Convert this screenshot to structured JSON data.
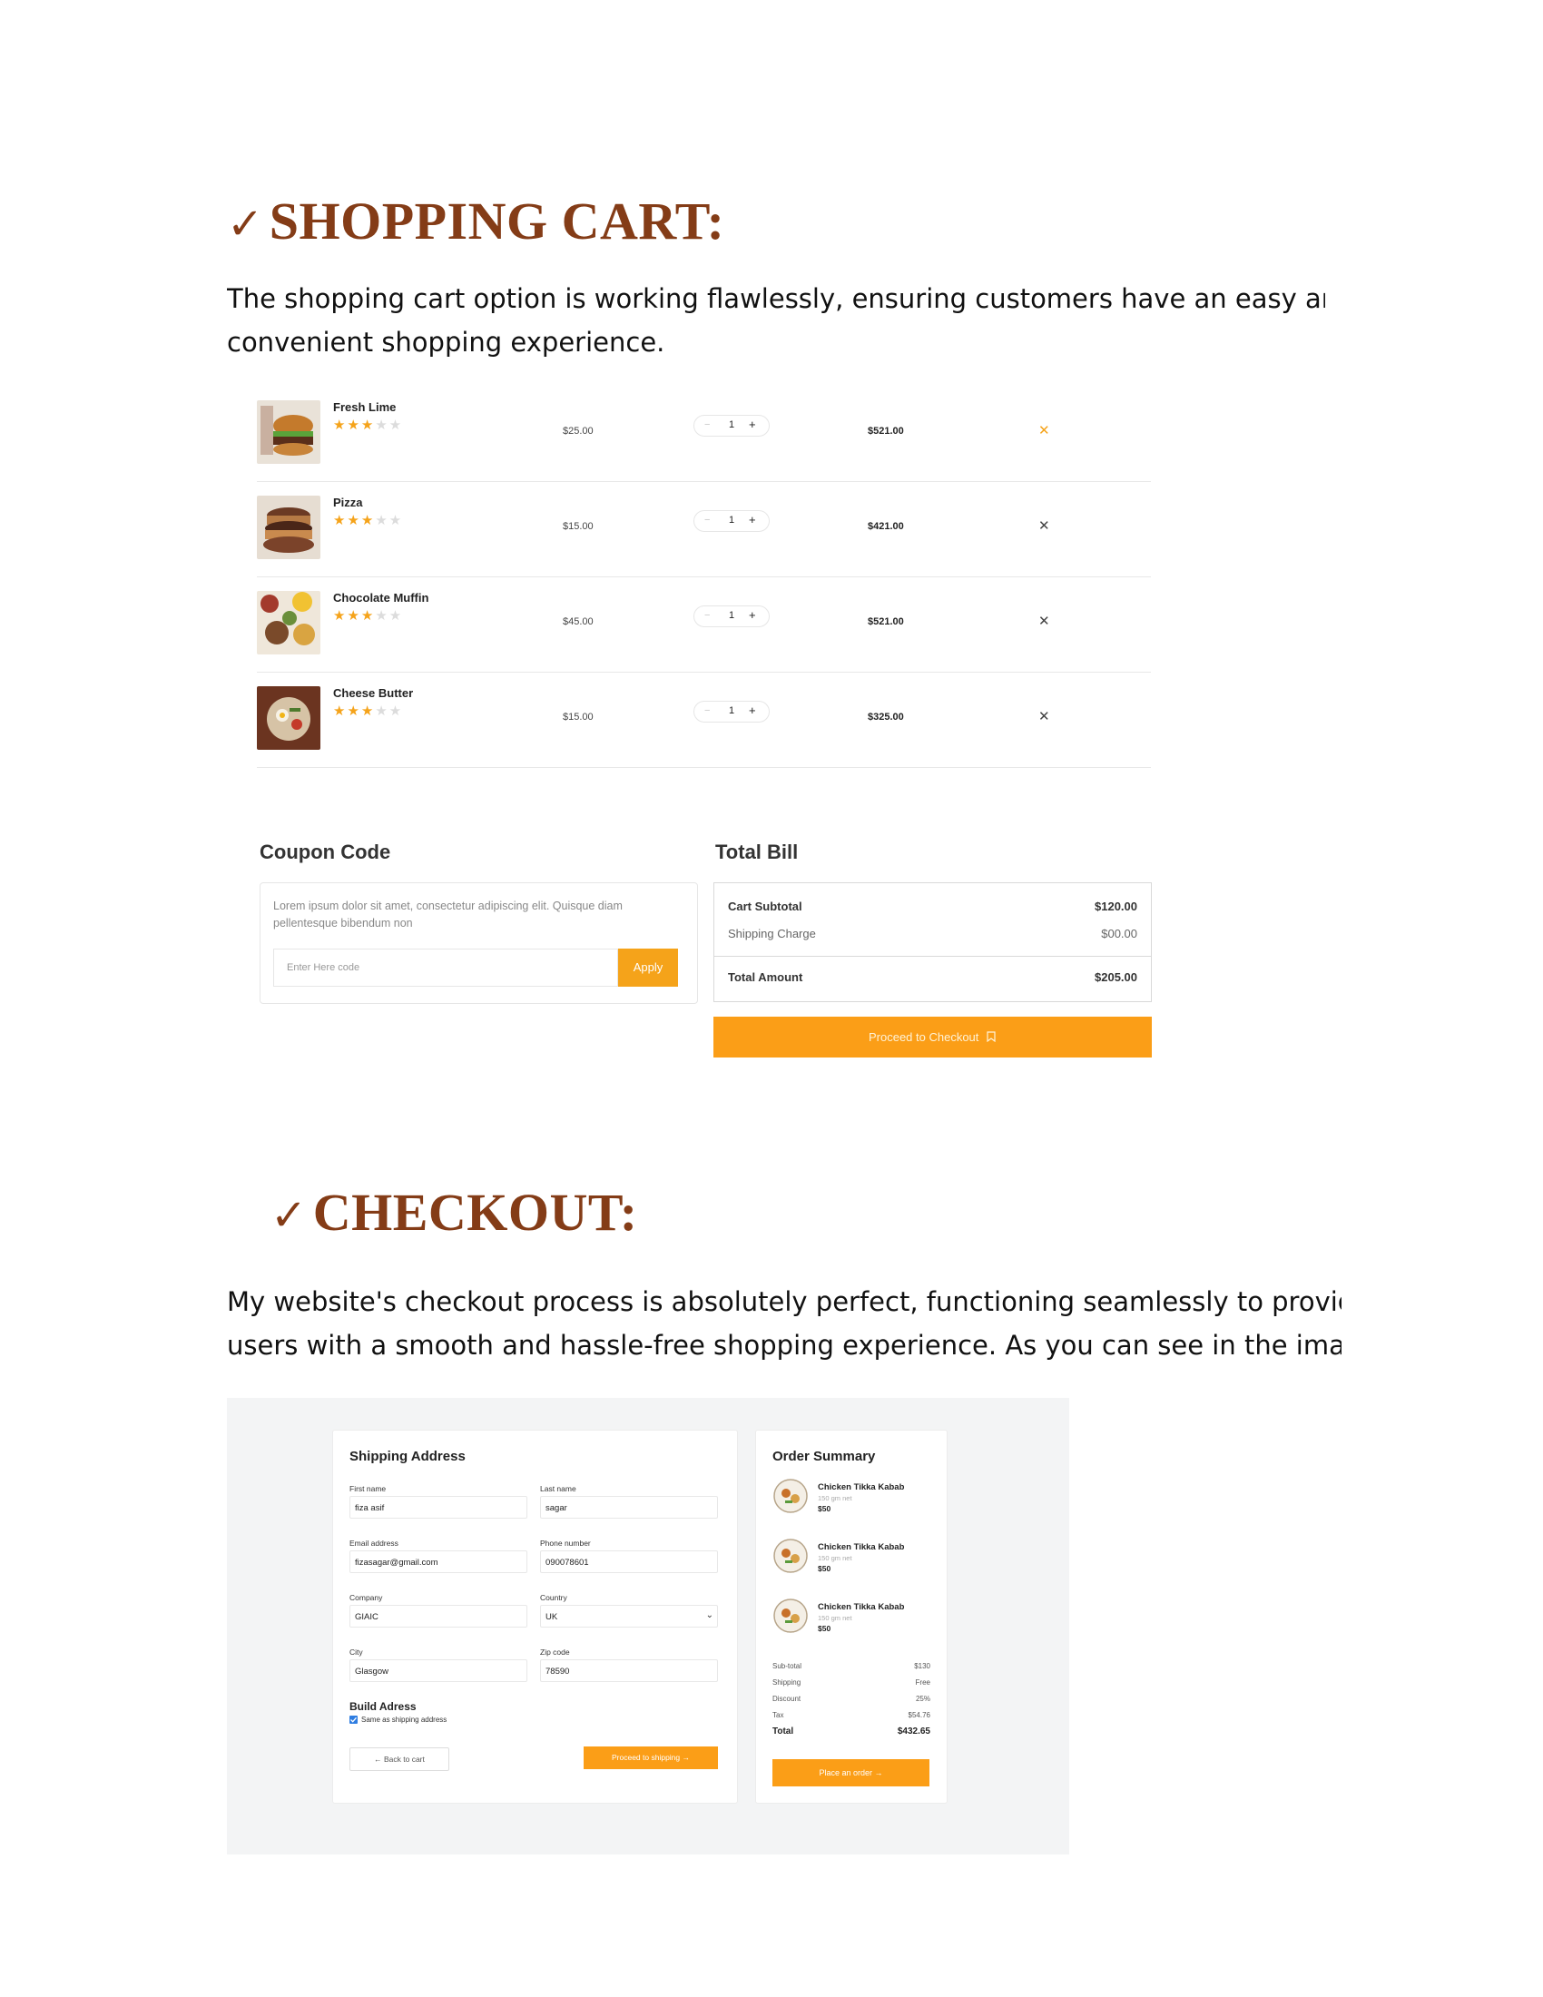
{
  "shopping_cart": {
    "heading": "SHOPPING CART:",
    "check": "✓",
    "paragraph_line1": "The shopping cart option is working flawlessly, ensuring customers have an easy and",
    "paragraph_line2": "convenient shopping experience.",
    "items": [
      {
        "name": "Fresh Lime",
        "rating": 3,
        "price": "$25.00",
        "qty": "1",
        "total": "$521.00"
      },
      {
        "name": "Pizza",
        "rating": 3,
        "price": "$15.00",
        "qty": "1",
        "total": "$421.00"
      },
      {
        "name": "Chocolate Muffin",
        "rating": 3,
        "price": "$45.00",
        "qty": "1",
        "total": "$521.00"
      },
      {
        "name": "Cheese Butter",
        "rating": 3,
        "price": "$15.00",
        "qty": "1",
        "total": "$325.00"
      }
    ],
    "minus_symbol": "−",
    "plus_symbol": "+",
    "remove_symbol": "✕",
    "coupon": {
      "title": "Coupon Code",
      "description": "Lorem ipsum dolor sit amet, consectetur adipiscing elit. Quisque diam pellentesque bibendum non",
      "placeholder": "Enter Here code",
      "apply_label": "Apply"
    },
    "bill": {
      "title": "Total Bill",
      "subtotal_label": "Cart Subtotal",
      "subtotal_value": "$120.00",
      "shipping_label": "Shipping Charge",
      "shipping_value": "$00.00",
      "total_label": "Total Amount",
      "total_value": "$205.00",
      "checkout_label": "Proceed to Checkout"
    }
  },
  "checkout": {
    "heading": "CHECKOUT:",
    "check": "✓",
    "paragraph_line1": "My website's checkout process is absolutely perfect, functioning seamlessly to provid",
    "paragraph_line2": "users with a smooth and hassle-free shopping experience. As you can see in the image",
    "shipping": {
      "title": "Shipping Address",
      "first_name_label": "First name",
      "first_name_value": "fiza asif",
      "last_name_label": "Last name",
      "last_name_value": "sagar",
      "email_label": "Email address",
      "email_value": "fizasagar@gmail.com",
      "phone_label": "Phone number",
      "phone_value": "090078601",
      "company_label": "Company",
      "company_value": "GIAIC",
      "country_label": "Country",
      "country_value": "UK",
      "city_label": "City",
      "city_value": "Glasgow",
      "zip_label": "Zip code",
      "zip_value": "78590",
      "build_title": "Build Adress",
      "same_as_label": "Same as shipping address",
      "same_as_checked": true,
      "back_label": "← Back to cart",
      "proceed_label": "Proceed to shipping →"
    },
    "summary": {
      "title": "Order Summary",
      "items": [
        {
          "name": "Chicken Tikka Kabab",
          "weight": "150 gm net",
          "price": "$50"
        },
        {
          "name": "Chicken Tikka Kabab",
          "weight": "150 gm net",
          "price": "$50"
        },
        {
          "name": "Chicken Tikka Kabab",
          "weight": "150 gm net",
          "price": "$50"
        }
      ],
      "subtotal_label": "Sub-total",
      "subtotal_value": "$130",
      "shipping_label": "Shipping",
      "shipping_value": "Free",
      "discount_label": "Discount",
      "discount_value": "25%",
      "tax_label": "Tax",
      "tax_value": "$54.76",
      "total_label": "Total",
      "total_value": "$432.65",
      "place_order_label": "Place an order →"
    }
  },
  "colors": {
    "heading": "#843c17",
    "accent": "#fb9e17",
    "star_on": "#f5a31a",
    "star_off": "#dcdcdc"
  }
}
